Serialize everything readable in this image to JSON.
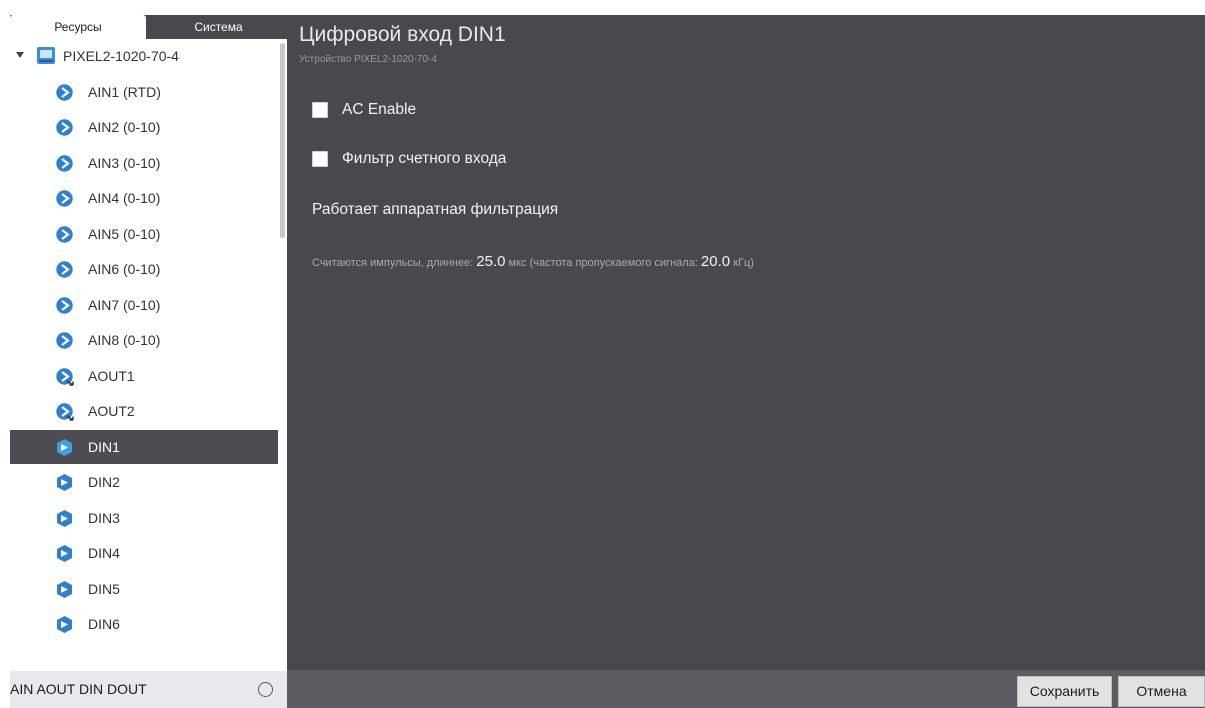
{
  "tabs": {
    "resources": "Ресурсы",
    "system": "Система"
  },
  "tree": {
    "root_label": "PIXEL2-1020-70-4",
    "items": [
      {
        "label": "AIN1 (RTD)",
        "icon": "analog-input-icon",
        "selected": false
      },
      {
        "label": "AIN2 (0-10)",
        "icon": "analog-input-icon",
        "selected": false
      },
      {
        "label": "AIN3 (0-10)",
        "icon": "analog-input-icon",
        "selected": false
      },
      {
        "label": "AIN4 (0-10)",
        "icon": "analog-input-icon",
        "selected": false
      },
      {
        "label": "AIN5 (0-10)",
        "icon": "analog-input-icon",
        "selected": false
      },
      {
        "label": "AIN6 (0-10)",
        "icon": "analog-input-icon",
        "selected": false
      },
      {
        "label": "AIN7 (0-10)",
        "icon": "analog-input-icon",
        "selected": false
      },
      {
        "label": "AIN8 (0-10)",
        "icon": "analog-input-icon",
        "selected": false
      },
      {
        "label": "AOUT1",
        "icon": "analog-output-icon",
        "selected": false
      },
      {
        "label": "AOUT2",
        "icon": "analog-output-icon",
        "selected": false
      },
      {
        "label": "DIN1",
        "icon": "digital-input-icon",
        "selected": true
      },
      {
        "label": "DIN2",
        "icon": "digital-input-icon",
        "selected": false
      },
      {
        "label": "DIN3",
        "icon": "digital-input-icon",
        "selected": false
      },
      {
        "label": "DIN4",
        "icon": "digital-input-icon",
        "selected": false
      },
      {
        "label": "DIN5",
        "icon": "digital-input-icon",
        "selected": false
      },
      {
        "label": "DIN6",
        "icon": "digital-input-icon",
        "selected": false
      }
    ]
  },
  "filter": {
    "text": "AIN AOUT DIN DOUT"
  },
  "main": {
    "title": "Цифровой вход DIN1",
    "subtitle": "Устройство PIXEL2-1020-70-4",
    "ac_enable_label": "AC Enable",
    "ac_enable_checked": false,
    "counter_filter_label": "Фильтр счетного входа",
    "counter_filter_checked": false,
    "hw_filter_note": "Работает аппаратная фильтрация",
    "pulse": {
      "prefix": "Считаются импульсы, длиннее:",
      "duration_value": "25.0",
      "duration_unit": "мкс",
      "freq_prefix": "(частота пропускаемого сигнала:",
      "freq_value": "20.0",
      "freq_unit": "кГц)"
    }
  },
  "footer": {
    "save_label": "Сохранить",
    "cancel_label": "Отмена"
  },
  "colors": {
    "panel_bg": "#47494e",
    "selected_row": "#4b4d52",
    "icon_blue": "#2f80d0"
  }
}
